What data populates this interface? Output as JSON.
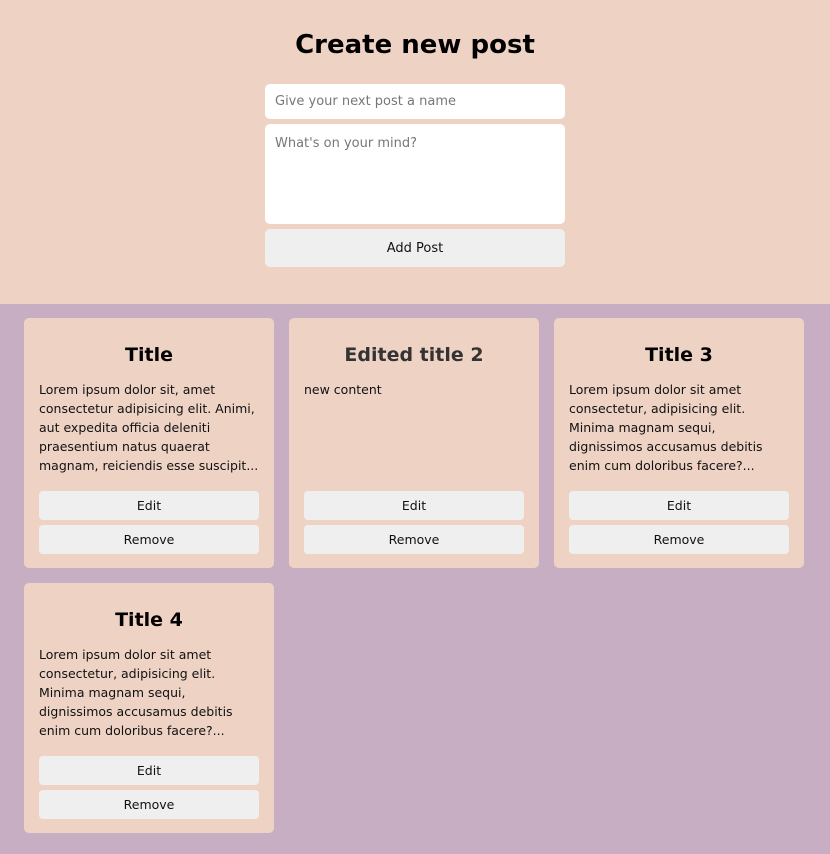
{
  "create": {
    "heading": "Create new post",
    "title_placeholder": "Give your next post a name",
    "content_placeholder": "What's on your mind?",
    "add_label": "Add Post"
  },
  "posts": [
    {
      "title": "Title",
      "body": "Lorem ipsum dolor sit, amet consectetur adipisicing elit. Animi, aut expedita officia deleniti praesentium natus quaerat magnam, reiciendis esse suscipit...",
      "edit_label": "Edit",
      "remove_label": "Remove"
    },
    {
      "title": "Edited title 2",
      "body": "new content",
      "edit_label": "Edit",
      "remove_label": "Remove"
    },
    {
      "title": "Title 3",
      "body": "Lorem ipsum dolor sit amet consectetur, adipisicing elit. Minima magnam sequi, dignissimos accusamus debitis enim cum doloribus facere?...",
      "edit_label": "Edit",
      "remove_label": "Remove"
    },
    {
      "title": "Title 4",
      "body": "Lorem ipsum dolor sit amet consectetur, adipisicing elit. Minima magnam sequi, dignissimos accusamus debitis enim cum doloribus facere?...",
      "edit_label": "Edit",
      "remove_label": "Remove"
    }
  ],
  "colors": {
    "page_background": "#c8aec2",
    "panel_background": "#eed3c5",
    "button_background": "#efefef"
  }
}
